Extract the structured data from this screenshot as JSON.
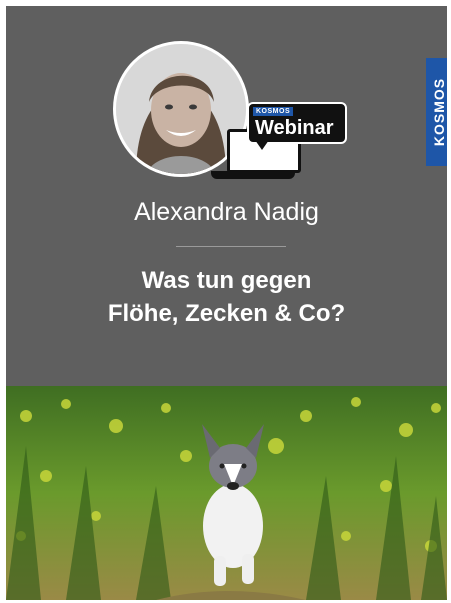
{
  "brand": {
    "logo_text": "KOSMOS",
    "blue": "#1e56a8"
  },
  "badge": {
    "small_logo": "KOSMOS",
    "label": "Webinar"
  },
  "speaker": {
    "name": "Alexandra Nadig"
  },
  "title": {
    "line1": "Was tun gegen",
    "line2": "Flöhe, Zecken & Co?"
  },
  "colors": {
    "header_bg": "#5f5f5f",
    "text": "#ffffff",
    "divider": "#9a9a9a"
  },
  "images": {
    "speaker_photo": "portrait of smiling woman",
    "cover_photo": "border collie puppy running through green field with yellow flowers"
  }
}
